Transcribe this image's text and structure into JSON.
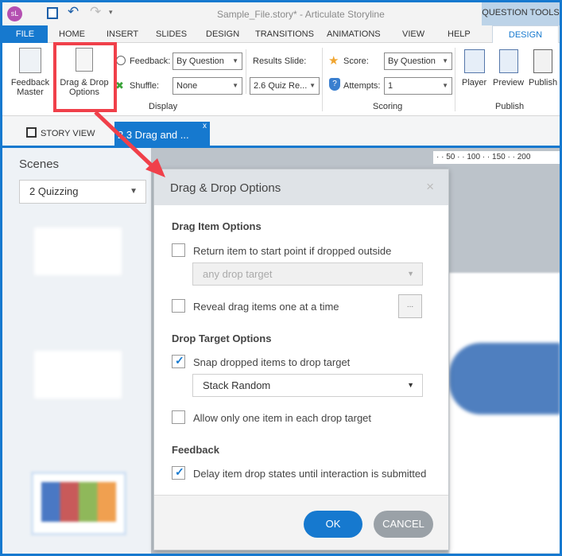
{
  "app": {
    "logo": "sL",
    "title": "Sample_File.story* -  Articulate Storyline",
    "context_tab": "QUESTION TOOLS"
  },
  "menu_tabs": [
    "FILE",
    "HOME",
    "INSERT",
    "SLIDES",
    "DESIGN",
    "TRANSITIONS",
    "ANIMATIONS",
    "VIEW",
    "HELP",
    "DESIGN"
  ],
  "ribbon": {
    "feedback_master": [
      "Feedback",
      "Master"
    ],
    "drag_drop": [
      "Drag & Drop",
      "Options"
    ],
    "feedback_label": "Feedback:",
    "feedback_value": "By Question",
    "shuffle_label": "Shuffle:",
    "shuffle_value": "None",
    "results_label": "Results Slide:",
    "results_value": "2.6 Quiz Re...",
    "display_group": "Display",
    "score_label": "Score:",
    "score_value": "By Question",
    "attempts_label": "Attempts:",
    "attempts_value": "1",
    "scoring_group": "Scoring",
    "player": "Player",
    "preview": "Preview",
    "publish": "Publish",
    "publish_group": "Publish"
  },
  "story_tabs": {
    "story_view": "STORY VIEW",
    "active": "2.3 Drag and ...",
    "close": "x"
  },
  "scenes": {
    "title": "Scenes",
    "selected": "2 Quizzing"
  },
  "ruler": "· · 50 · · 100 · · 150 · · 200",
  "dialog": {
    "title": "Drag & Drop Options",
    "close": "×",
    "drag_item_section": "Drag Item Options",
    "return_item": {
      "label": "Return item to start point if dropped outside",
      "checked": false
    },
    "return_target": "any drop target",
    "reveal": {
      "label": "Reveal drag items one at a time",
      "checked": false
    },
    "more_button": "...",
    "drop_target_section": "Drop Target Options",
    "snap": {
      "label": "Snap dropped items to drop target",
      "checked": true
    },
    "snap_mode": "Stack Random",
    "one_item": {
      "label": "Allow only one item in each drop target",
      "checked": false
    },
    "feedback_section": "Feedback",
    "delay": {
      "label": "Delay item drop states until interaction is submitted",
      "checked": true
    },
    "ok": "OK",
    "cancel": "CANCEL"
  },
  "colors": {
    "accent": "#1679cf",
    "highlight": "#f0404a",
    "cancel": "#9aa1a7"
  }
}
